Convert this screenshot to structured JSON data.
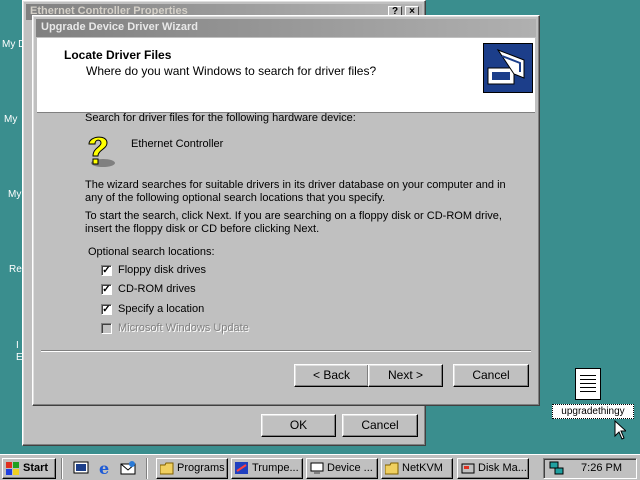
{
  "desktop": {
    "icon_labels": [
      "My D",
      "My",
      "My",
      "Re",
      "I",
      "E"
    ],
    "file_icon_label": "upgradethingy"
  },
  "props_window": {
    "title": "Ethernet Controller Properties",
    "help_glyph": "?",
    "close_glyph": "×",
    "ok_label": "OK",
    "cancel_label": "Cancel"
  },
  "wizard": {
    "title": "Upgrade Device Driver Wizard",
    "header_title": "Locate Driver Files",
    "header_subtitle": "Where do you want Windows to search for driver files?",
    "search_prompt": "Search for driver files for the following hardware device:",
    "device_name": "Ethernet Controller",
    "device_icon": "question-mark-device-icon",
    "description_1": "The wizard searches for suitable drivers in its driver database on your computer and in",
    "description_2": "any of the following optional search locations that you specify.",
    "instruction_1": "To start the search, click Next. If you are searching on a floppy disk or CD-ROM drive,",
    "instruction_2": "insert the floppy disk or CD before clicking Next.",
    "optional_label": "Optional search locations:",
    "options": [
      {
        "label": "Floppy disk drives",
        "checked": true,
        "enabled": true
      },
      {
        "label": "CD-ROM drives",
        "checked": true,
        "enabled": true
      },
      {
        "label": "Specify a location",
        "checked": true,
        "enabled": true
      },
      {
        "label": "Microsoft Windows Update",
        "checked": false,
        "enabled": false
      }
    ],
    "back_label": "< Back",
    "next_label": "Next >",
    "cancel_label": "Cancel"
  },
  "taskbar": {
    "start_label": "Start",
    "quick_launch": [
      "show-desktop-icon",
      "internet-explorer-icon",
      "outlook-express-icon"
    ],
    "tasks": [
      "Programs",
      "Trumpe...",
      "Device ...",
      "NetKVM",
      "Disk Ma..."
    ],
    "clock": "7:26 PM"
  },
  "colors": {
    "desktop": "#3a8e8e",
    "face": "#c0c0c0",
    "inactive_title": "#808080",
    "header_graphic": "#1c3e8a"
  }
}
